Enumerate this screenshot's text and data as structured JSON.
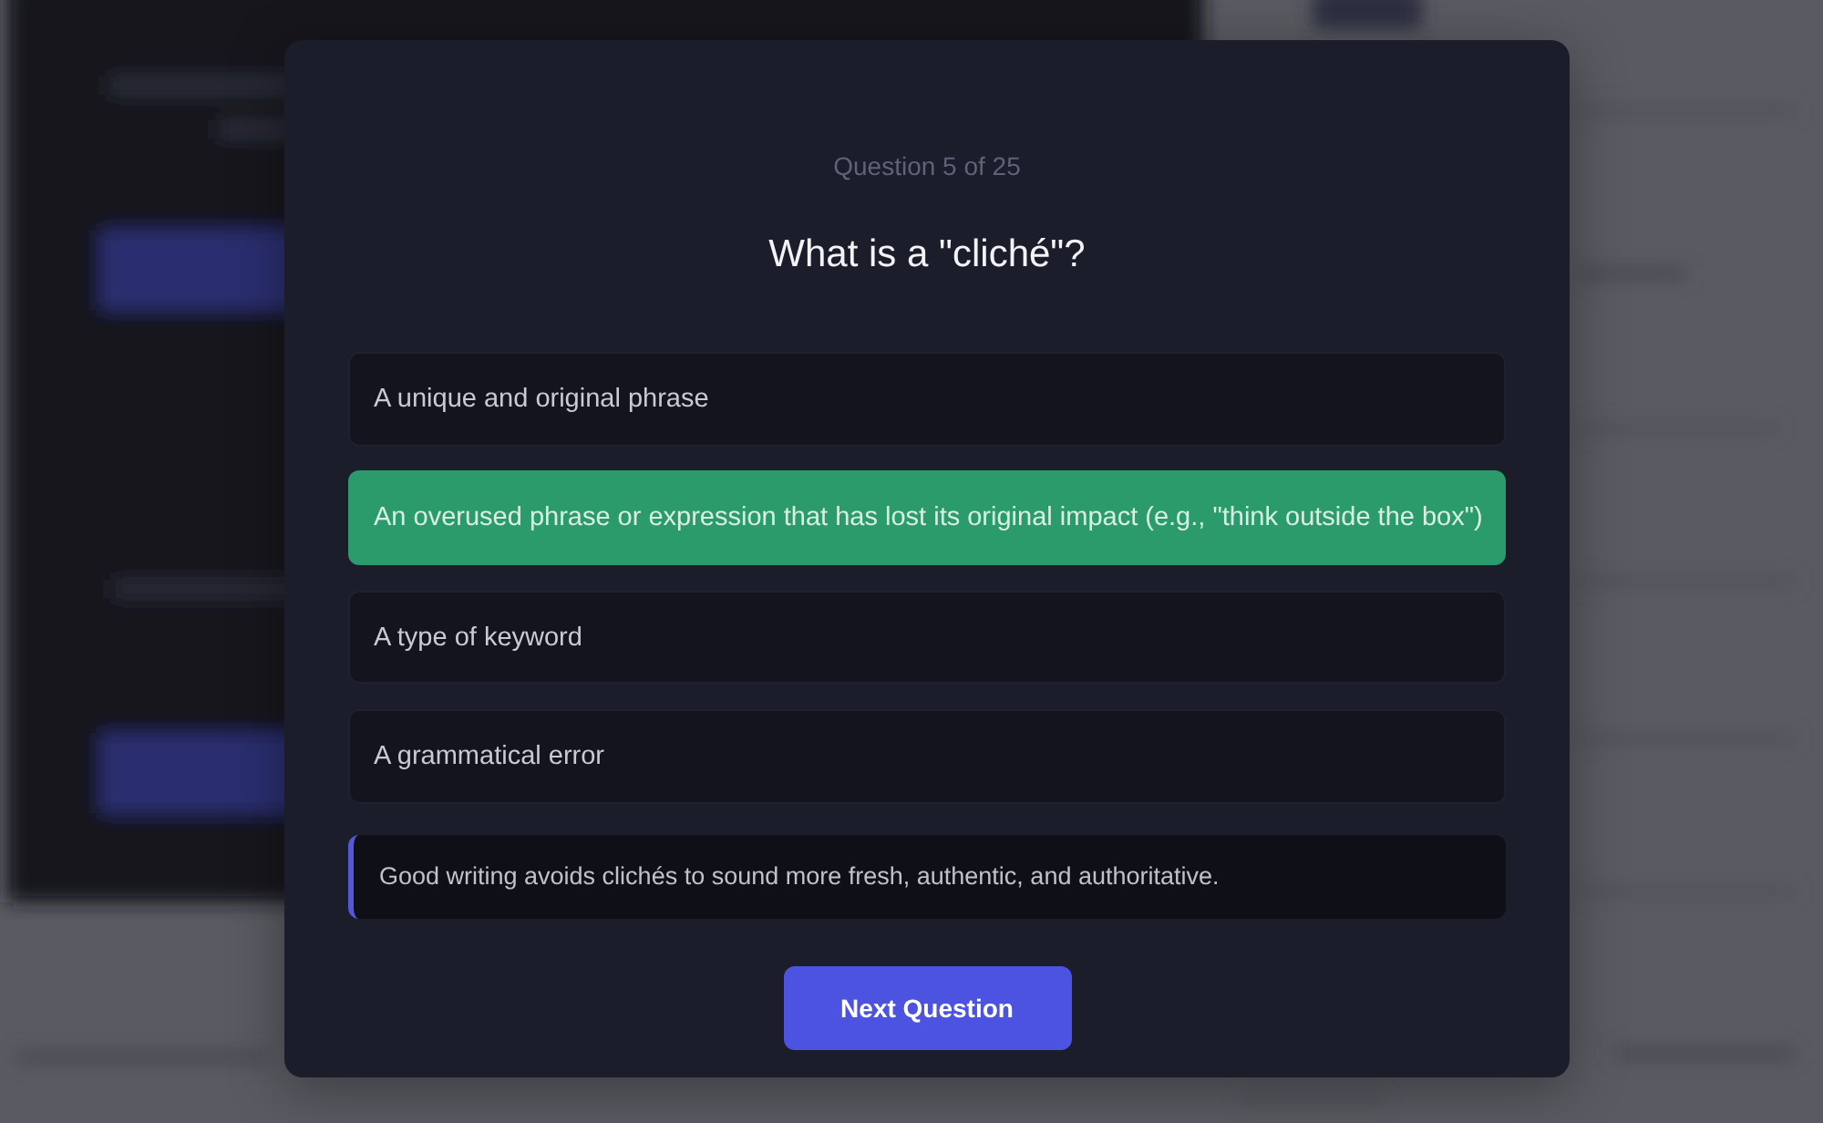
{
  "quiz_dialog": {
    "progress": "Question 5 of 25",
    "question": "What is a \"cliché\"?",
    "options": [
      {
        "text": "A unique and original phrase",
        "correct": false
      },
      {
        "text": "An overused phrase or expression that has lost its original impact (e.g., \"think outside the box\")",
        "correct": true
      },
      {
        "text": "A type of keyword",
        "correct": false
      },
      {
        "text": "A grammatical error",
        "correct": false
      }
    ],
    "explanation": "Good writing avoids clichés to sound more fresh, authentic, and authoritative.",
    "next_button": "Next Question"
  }
}
